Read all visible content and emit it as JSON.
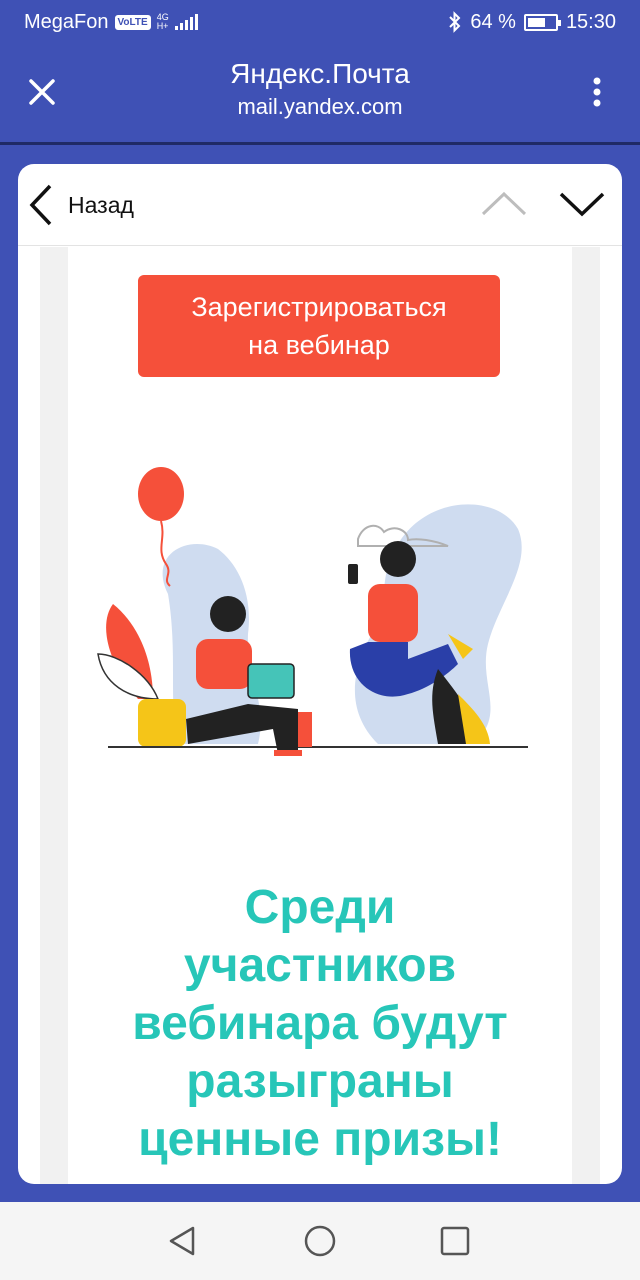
{
  "status_bar": {
    "carrier": "MegaFon",
    "volte": "VoLTE",
    "network_top": "4G",
    "network_bottom": "H+",
    "battery_percent": "64 %",
    "battery_level": 0.64,
    "time": "15:30",
    "icons": [
      "signal-icon",
      "bluetooth-icon",
      "battery-icon"
    ]
  },
  "app_bar": {
    "title": "Яндекс.Почта",
    "subtitle": "mail.yandex.com",
    "icons": [
      "close-icon",
      "more-vert-icon"
    ]
  },
  "mail_header": {
    "back_label": "Назад",
    "icons": [
      "chevron-left-icon",
      "chevron-up-icon",
      "chevron-down-icon"
    ]
  },
  "email": {
    "cta_line1": "Зарегистрироваться",
    "cta_line2": "на вебинар",
    "promo_lines": [
      "Среди",
      "участников",
      "вебинара будут",
      "разыграны",
      "ценные призы!"
    ]
  },
  "nav_bar": {
    "icons": [
      "nav-back-icon",
      "nav-home-icon",
      "nav-recents-icon"
    ]
  },
  "colors": {
    "app_bar": "#3f51b5",
    "cta": "#f5503a",
    "promo_text": "#27c6b8"
  }
}
